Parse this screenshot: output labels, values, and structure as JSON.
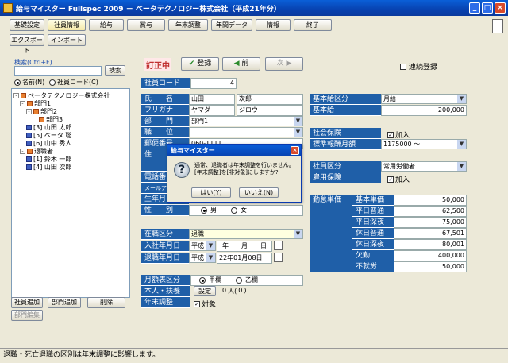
{
  "window": {
    "title": "給与マイスター Fullspec 2009 － ベータテクノロジー株式会社（平成21年分）"
  },
  "toolbar": {
    "row1": [
      "基礎設定",
      "社員情報",
      "給与",
      "賞与",
      "年末調整",
      "年間データ",
      "情報",
      "終了"
    ],
    "row2": [
      "エクスポート",
      "インポート"
    ]
  },
  "search": {
    "label": "検索(Ctrl+F)",
    "button": "検索",
    "opt_name": "名前(N)",
    "opt_code": "社員コード(C)"
  },
  "tree": {
    "company": "ベータテクノロジー株式会社",
    "dept1": "部門1",
    "dept2": "部門2",
    "dept3": "部門3",
    "emp3": "[3] 山田 太郎",
    "emp5": "[5] ベータ 聡",
    "emp6": "[6] 山中 秀人",
    "retired": "退職者",
    "emp1": "[1] 鈴木 一郎",
    "emp4": "[4] 山田 次郎"
  },
  "left_buttons": {
    "add_employee": "社員追加",
    "add_dept": "部門追加",
    "delete": "削除",
    "edit_dept": "部門編集"
  },
  "record": {
    "mode": "訂正中",
    "register": "登録",
    "prev": "前",
    "next": "次",
    "continuous": "連続登録"
  },
  "labels": {
    "code": "社員コード",
    "name": "氏　　名",
    "furigana": "フリガナ",
    "dept": "部　　門",
    "position": "職　　位",
    "postal": "郵便番号",
    "address": "住",
    "phone": "電話番号",
    "mail": "メールアドレス",
    "birth": "生年月日",
    "sex": "性　　別",
    "status": "在職区分",
    "join": "入社年月日",
    "leave": "退職年月日",
    "tax_table": "月額表区分",
    "dependents": "本人・扶養",
    "year_end": "年末調整",
    "base_type": "基本給区分",
    "base_pay": "基本給",
    "social": "社会保険",
    "std_pay": "標準報酬月額",
    "emp_type": "社員区分",
    "employment": "雇用保険",
    "unit": "勤怠単価"
  },
  "values": {
    "code": "4",
    "last_name": "山田",
    "first_name": "次郎",
    "kana_last": "ヤマダ",
    "kana_first": "ジロウ",
    "dept": "部門1",
    "postal": "060-1111",
    "sex_m": "男",
    "sex_f": "女",
    "status": "退職",
    "era1": "平成",
    "join_date": "年　　月　　日",
    "era2": "平成",
    "leave_date": "22年01月08日",
    "tax_kou": "甲欄",
    "tax_otsu": "乙欄",
    "setting": "設定",
    "dep_count": "0",
    "dep_unit": "人(",
    "dep_close": "0",
    "dep_end": ")",
    "year_end_target": "対象",
    "base_type": "月給",
    "base_pay": "200,000",
    "social_join": "加入",
    "std_pay": "1175000 〜",
    "emp_type": "常用労働者",
    "employment_join": "加入"
  },
  "units": [
    {
      "label": "基本単価",
      "value": "50,000"
    },
    {
      "label": "平日普通",
      "value": "62,500"
    },
    {
      "label": "平日深夜",
      "value": "75,000"
    },
    {
      "label": "休日普通",
      "value": "67,501"
    },
    {
      "label": "休日深夜",
      "value": "80,001"
    },
    {
      "label": "欠勤",
      "value": "400,000"
    },
    {
      "label": "不就労",
      "value": "50,000"
    }
  ],
  "dialog": {
    "title": "給与マイスター",
    "message": "通常、退職者は年末調整を行いません。[年末調整]を[非対象]にしますか?",
    "yes": "はい(Y)",
    "no": "いいえ(N)"
  },
  "status_bar": "退職・死亡退職の区別は年末調整に影響します。"
}
